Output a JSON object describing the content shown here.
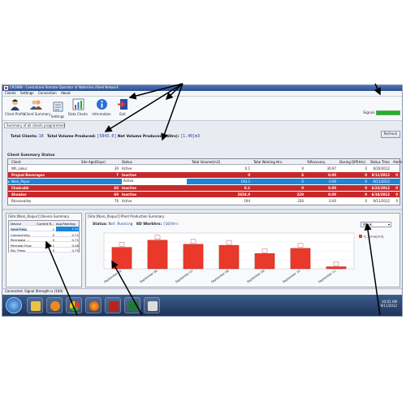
{
  "window": {
    "title": "CROWN - Centralized Remote Operator of Waterline Allied Network"
  },
  "menu": [
    "Clients",
    "Settings",
    "Connection",
    "About"
  ],
  "toolbar": {
    "items": [
      {
        "label": "Client Profile",
        "icon": "client-profile-icon"
      },
      {
        "label": "Client Summary",
        "icon": "client-summary-icon"
      },
      {
        "label": "Settings",
        "icon": "settings-icon"
      },
      {
        "label": "Data Charts",
        "icon": "data-charts-icon"
      },
      {
        "label": "Information",
        "icon": "information-icon"
      },
      {
        "label": "Exit",
        "icon": "exit-icon"
      }
    ]
  },
  "signal": {
    "label": "Signal",
    "level": 1.0,
    "color": "#22b02a"
  },
  "summary_bar": {
    "label": "Summary of all clients programmed"
  },
  "totals": {
    "clients_label": "Total Clients:",
    "clients_value": "18",
    "volume_label": "Total Volume Produced:",
    "volume_value": "[5843.0]",
    "net_label": "Net Volume Produced(24Hrs):",
    "net_value": "[1.40]m3"
  },
  "refresh_label": "Refresh",
  "client_summary": {
    "title": "Client Summary Status",
    "columns": [
      "Client",
      "Site Age(Days)",
      "Status",
      "Total Volume[m3]",
      "Total Working Hrs.",
      "%Recovery",
      "Dosing Diff(Hrs)",
      "Status Time",
      "Alerts"
    ],
    "rows": [
      {
        "cells": [
          "Wh_Lokur",
          "30",
          "Active",
          "0.1",
          "0",
          "30.97",
          "0",
          "6/20/2012",
          ""
        ],
        "style": "wh"
      },
      {
        "cells": [
          "Prajnal Beverages",
          "7",
          "Inactive",
          "0",
          "6",
          "0.00",
          "0",
          "9/11/2012",
          "0"
        ],
        "style": "red"
      },
      {
        "cells": [
          "Nero_Papur",
          "",
          "Active",
          "193.2",
          "5",
          "0.00",
          "0",
          "9/11/2012",
          ""
        ],
        "style": "sel"
      },
      {
        "cells": [
          "Chakrabh",
          "60",
          "Inactive",
          "0.1",
          "0",
          "0.00",
          "0",
          "6/23/2012",
          "0"
        ],
        "style": "red"
      },
      {
        "cells": [
          "Shoukar",
          "60",
          "Inactive",
          "2654.9",
          "220",
          "0.00",
          "0",
          "6/18/2012",
          "0"
        ],
        "style": "red"
      },
      {
        "cells": [
          "Bhavavalley",
          "76",
          "Active",
          "194",
          "336",
          "0.00",
          "0",
          "9/11/2012",
          "0"
        ],
        "style": "wh"
      }
    ]
  },
  "device_summary": {
    "title": "[Site:[Naro_Raipur]] Device Summary",
    "columns": [
      "Device",
      "Current R...",
      "Avg.Reading"
    ],
    "rows": [
      [
        "Feed Press",
        "1",
        "1.11"
      ],
      [
        "Conductivity",
        "0",
        "0.71"
      ],
      [
        "Permeate ...",
        "0",
        "0.71"
      ],
      [
        "Permeat Flow",
        "1",
        "0.46"
      ],
      [
        "Rej. Press",
        "0",
        "0.75"
      ]
    ]
  },
  "production": {
    "title": "[Site:[Naro_Raipur]] Plant Production Summary",
    "status_label": "Status:",
    "status_value": "Not Running",
    "workhrs_label": "8D Workhrs:",
    "workhrs_value": "[10]Hrs",
    "period_selected": "Week",
    "chart_data": {
      "type": "bar",
      "categories": [
        "September 05",
        "September 06",
        "September 07",
        "September 08",
        "September 09",
        "September 10",
        "September 11"
      ],
      "values": [
        4.2,
        5.6,
        4.8,
        4.6,
        3.0,
        4.0,
        0.4
      ],
      "legend": "V...lume[m3]",
      "ylim": [
        0,
        7
      ],
      "bar_color": "#e8392a"
    }
  },
  "statusbar": {
    "text": "Connected. Signal Strength is (100)"
  },
  "taskbar": {
    "apps": [
      "folder",
      "media-player",
      "chrome",
      "firefox",
      "acrobat",
      "excel",
      "paint"
    ],
    "time": "10:01 AM",
    "date": "9/11/2012"
  }
}
